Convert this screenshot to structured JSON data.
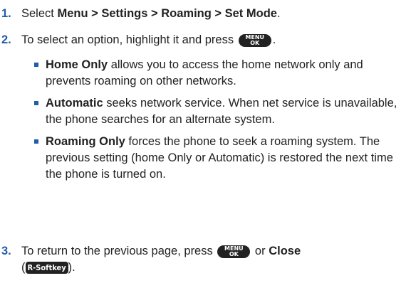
{
  "steps": [
    {
      "number": "1.",
      "prefix": "Select ",
      "bold": "Menu > Settings > Roaming > Set Mode",
      "suffix": "."
    },
    {
      "number": "2.",
      "text": "To select an option, highlight it and press",
      "end": ".",
      "bullets": [
        {
          "bold": "Home Only",
          "text": " allows you to access the home network only and prevents roaming on other networks."
        },
        {
          "bold": "Automatic",
          "text": " seeks network service. When net service is unavailable, the phone searches for an alternate system."
        },
        {
          "bold": "Roaming Only",
          "text": " forces the phone to seek a roaming system. The previous setting (home Only or Automatic) is restored the next time the phone is turned on."
        }
      ]
    },
    {
      "number": "3.",
      "text_a": "To return to the previous page, press",
      "text_b": " or ",
      "bold": "Close",
      "paren_open": "(",
      "paren_close": ")."
    }
  ],
  "keys": {
    "menu_top": "MENU",
    "menu_bottom": "OK",
    "softkey": "R-Softkey"
  },
  "colors": {
    "accent": "#1f5ea8",
    "text": "#222222"
  }
}
